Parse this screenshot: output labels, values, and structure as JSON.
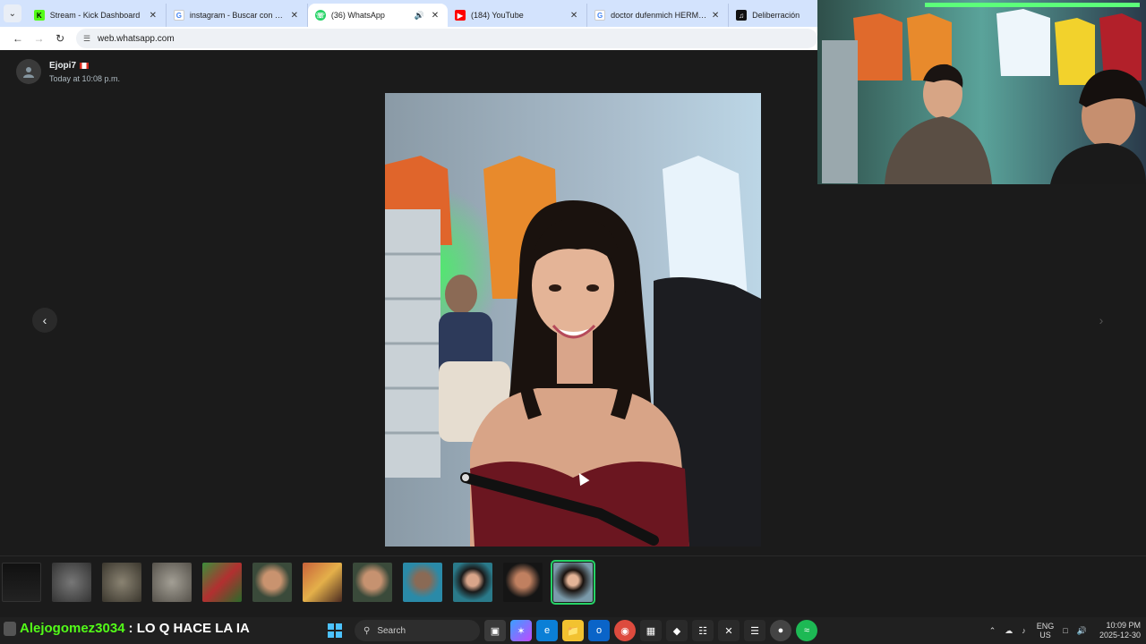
{
  "browser": {
    "tabs": [
      {
        "title": "Stream - Kick Dashboard",
        "icon": "kick-icon",
        "color": "#53fc18",
        "active": false
      },
      {
        "title": "instagram - Buscar con Google",
        "icon": "google-icon",
        "color": "#4285f4",
        "active": false
      },
      {
        "title": "(36) WhatsApp",
        "icon": "whatsapp-icon",
        "color": "#25d366",
        "active": true
      },
      {
        "title": "(184) YouTube",
        "icon": "youtube-icon",
        "color": "#ff0000",
        "active": false
      },
      {
        "title": "doctor dufenmich HERMA O - ",
        "icon": "google-icon",
        "color": "#4285f4",
        "active": false
      },
      {
        "title": "Deliberración",
        "icon": "tiktok-icon",
        "color": "#111111",
        "active": false
      }
    ],
    "url": "web.whatsapp.com"
  },
  "viewer": {
    "sender_name": "Ejopi7",
    "timestamp": "Today at 10:08 p.m.",
    "thumbnail_count": 12,
    "selected_thumbnail": 12,
    "accent": "#25d366"
  },
  "chat_overlay": {
    "username": "Alejogomez3034",
    "message": ": LO Q HACE LA IA"
  },
  "taskbar": {
    "search_placeholder": "Search",
    "language": "ENG",
    "region": "US",
    "time": "10:09 PM",
    "date": "2025-12-30"
  }
}
